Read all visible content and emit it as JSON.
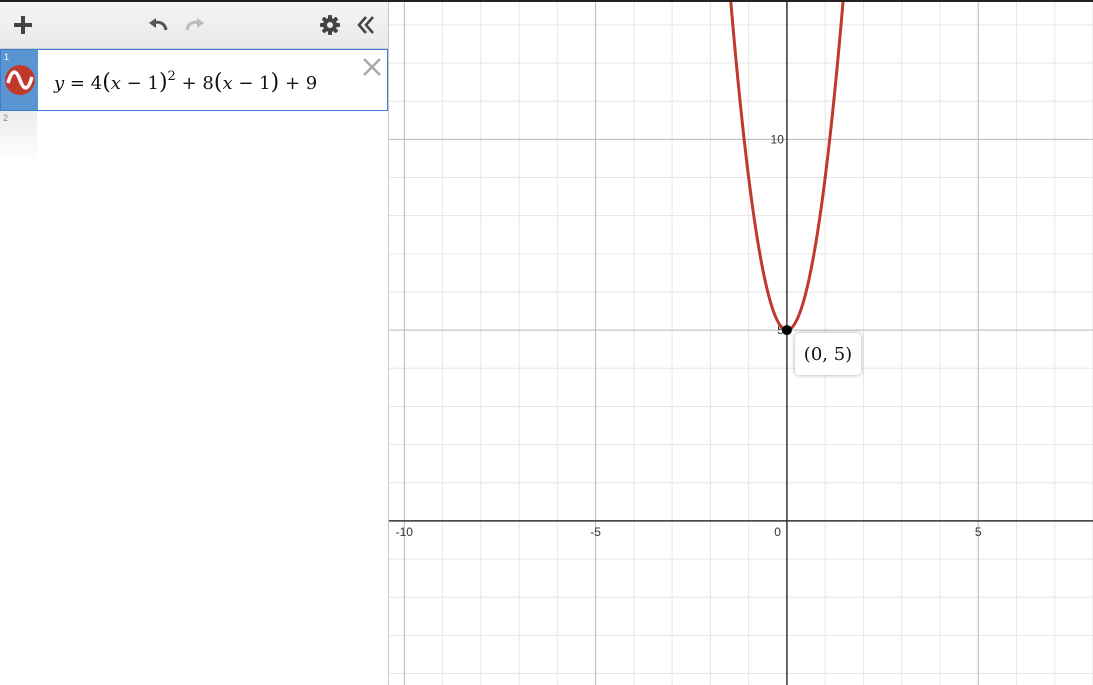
{
  "toolbar": {
    "add_icon": "plus-icon",
    "undo_icon": "undo-icon",
    "redo_icon": "redo-icon",
    "settings_icon": "gear-icon",
    "collapse_icon": "double-chevron-left-icon"
  },
  "expressions": [
    {
      "index": "1",
      "color": "#c0392b",
      "formula": {
        "y": "y",
        "eq": "=",
        "c1": "4",
        "x1": "x",
        "m1": "−",
        "one1": "1",
        "pow": "2",
        "plus1": "+",
        "c2": "8",
        "x2": "x",
        "m2": "−",
        "one2": "1",
        "plus2": "+",
        "c3": "9"
      }
    },
    {
      "index": "2"
    }
  ],
  "graph": {
    "x_tick_labels": [
      "-10",
      "-5",
      "0",
      "5"
    ],
    "y_tick_labels": [
      "10",
      "5"
    ],
    "point_label": "(0, 5)"
  },
  "chart_data": {
    "type": "line",
    "function": "y = 4(x-1)^2 + 8(x-1) + 9",
    "series": [
      {
        "color": "#c0392b",
        "x": [
          -1.5,
          -1.25,
          -1,
          -0.75,
          -0.5,
          -0.25,
          0,
          0.25,
          0.5,
          0.75,
          1,
          1.25,
          1.5
        ],
        "y": [
          14,
          11.25,
          9,
          7.25,
          6,
          5.25,
          5,
          5.25,
          6,
          7.25,
          9,
          11.25,
          14
        ]
      }
    ],
    "point": {
      "x": 0,
      "y": 5,
      "label": "(0, 5)"
    },
    "xlim": [
      -10.4,
      8
    ],
    "ylim": [
      -4.3,
      13.6
    ],
    "xticks": [
      -10,
      -5,
      0,
      5
    ],
    "yticks": [
      5,
      10
    ],
    "grid": true
  }
}
